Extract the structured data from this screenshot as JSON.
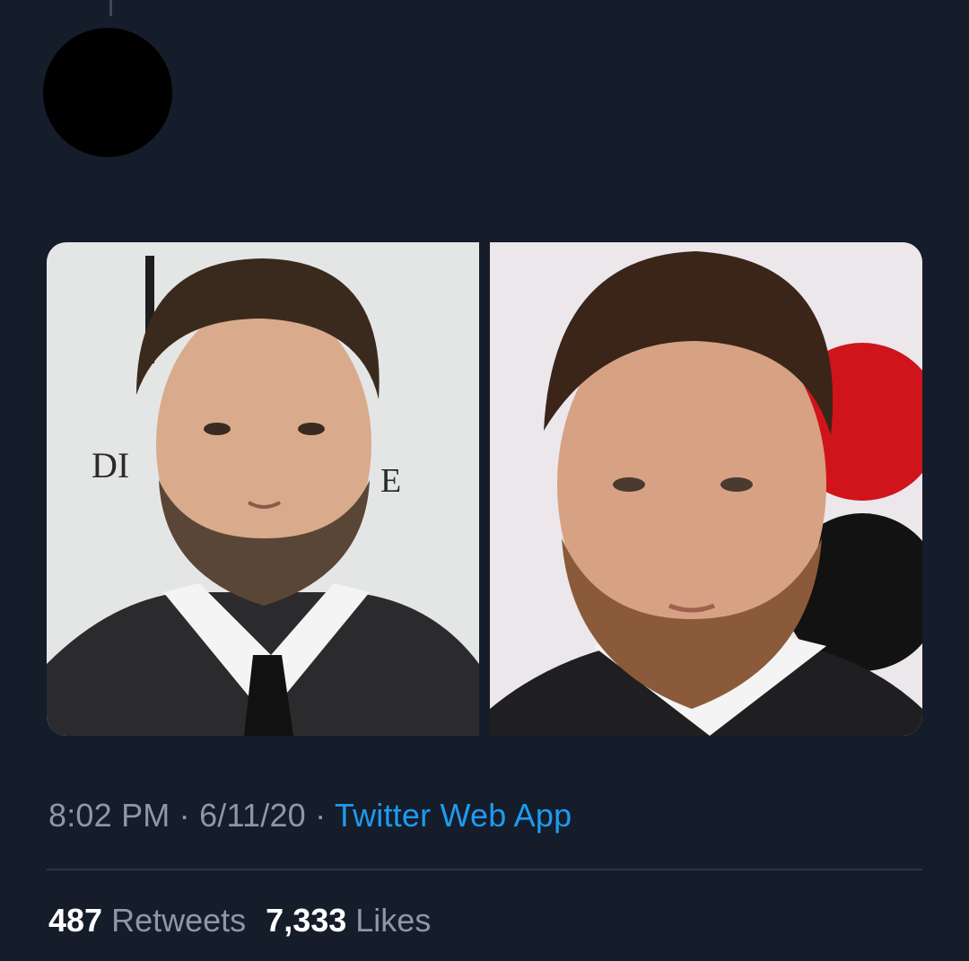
{
  "tweet": {
    "time": "8:02 PM",
    "date": "6/11/20",
    "source": "Twitter Web App",
    "separator": " · ",
    "stats": {
      "retweets_count": "487",
      "retweets_label": "Retweets",
      "likes_count": "7,333",
      "likes_label": "Likes"
    },
    "media": [
      {
        "name": "photo-left-bearded-man",
        "backdrop_text_left": "DI",
        "backdrop_text_right": "E"
      },
      {
        "name": "photo-right-bearded-man"
      }
    ]
  },
  "colors": {
    "background": "#151c2a",
    "link": "#1d9bf0",
    "muted": "#8b98a5",
    "count": "#ffffff"
  }
}
